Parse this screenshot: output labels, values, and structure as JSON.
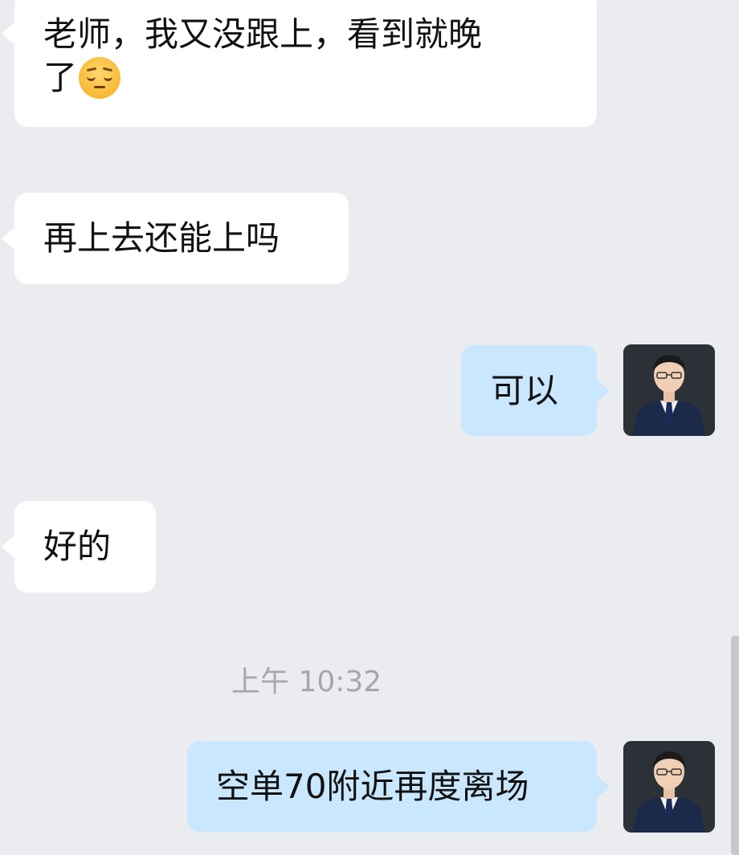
{
  "messages": [
    {
      "side": "left",
      "text": "老师，我又没跟上，看到就晚\n了",
      "emoji": "pensive-face"
    },
    {
      "side": "left",
      "text": "再上去还能上吗"
    },
    {
      "side": "right",
      "text": "可以"
    },
    {
      "side": "left",
      "text": "好的"
    },
    {
      "side": "right",
      "text": "空单70附近再度离场"
    }
  ],
  "timestamp": "上午 10:32",
  "colors": {
    "background": "#ebecf0",
    "incoming_bubble": "#ffffff",
    "outgoing_bubble": "#c9e7ff",
    "timestamp_text": "#a5a7ab"
  }
}
